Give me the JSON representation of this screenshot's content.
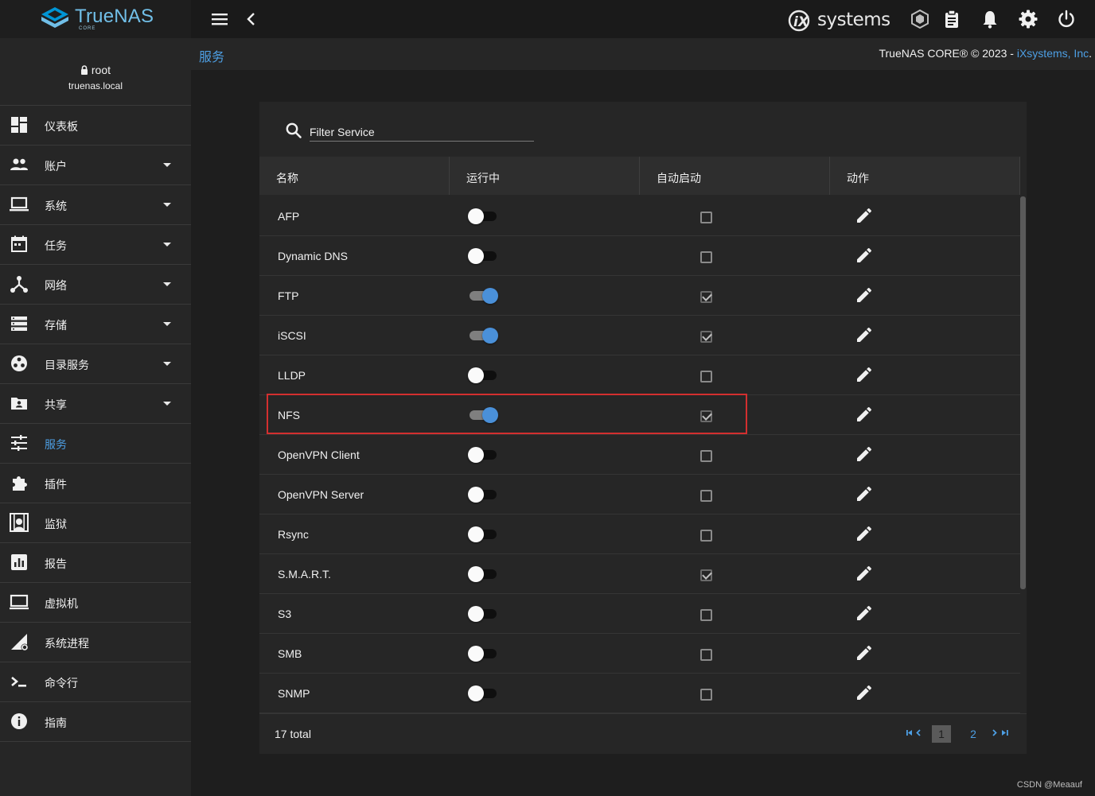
{
  "brand": {
    "name": "TrueNAS",
    "edition": "CORE"
  },
  "vendor": {
    "logo_mark": "iX",
    "logo_text": "systems"
  },
  "breadcrumb": "服务",
  "copyright": {
    "text": "TrueNAS CORE® © 2023 - ",
    "link": "iXsystems, Inc",
    "suffix": "."
  },
  "user": {
    "name": "root",
    "host": "truenas.local"
  },
  "nav": [
    {
      "label": "仪表板",
      "icon": "dashboard-icon",
      "caret": false,
      "active": false
    },
    {
      "label": "账户",
      "icon": "people-icon",
      "caret": true,
      "active": false
    },
    {
      "label": "系统",
      "icon": "laptop-icon",
      "caret": true,
      "active": false
    },
    {
      "label": "任务",
      "icon": "calendar-icon",
      "caret": true,
      "active": false
    },
    {
      "label": "网络",
      "icon": "network-icon",
      "caret": true,
      "active": false
    },
    {
      "label": "存储",
      "icon": "storage-icon",
      "caret": true,
      "active": false
    },
    {
      "label": "目录服务",
      "icon": "directory-icon",
      "caret": true,
      "active": false
    },
    {
      "label": "共享",
      "icon": "share-folder-icon",
      "caret": true,
      "active": false
    },
    {
      "label": "服务",
      "icon": "tune-icon",
      "caret": false,
      "active": true
    },
    {
      "label": "插件",
      "icon": "puzzle-icon",
      "caret": false,
      "active": false
    },
    {
      "label": "监狱",
      "icon": "jail-icon",
      "caret": false,
      "active": false
    },
    {
      "label": "报告",
      "icon": "chart-icon",
      "caret": false,
      "active": false
    },
    {
      "label": "虚拟机",
      "icon": "computer-icon",
      "caret": false,
      "active": false
    },
    {
      "label": "系统进程",
      "icon": "processes-icon",
      "caret": false,
      "active": false
    },
    {
      "label": "命令行",
      "icon": "terminal-icon",
      "caret": false,
      "active": false
    },
    {
      "label": "指南",
      "icon": "info-icon",
      "caret": false,
      "active": false
    }
  ],
  "filter": {
    "placeholder": "Filter Service"
  },
  "table": {
    "columns": [
      "名称",
      "运行中",
      "自动启动",
      "动作"
    ],
    "rows": [
      {
        "name": "AFP",
        "running": false,
        "autostart": false
      },
      {
        "name": "Dynamic DNS",
        "running": false,
        "autostart": false
      },
      {
        "name": "FTP",
        "running": true,
        "autostart": true
      },
      {
        "name": "iSCSI",
        "running": true,
        "autostart": true
      },
      {
        "name": "LLDP",
        "running": false,
        "autostart": false
      },
      {
        "name": "NFS",
        "running": true,
        "autostart": true
      },
      {
        "name": "OpenVPN Client",
        "running": false,
        "autostart": false
      },
      {
        "name": "OpenVPN Server",
        "running": false,
        "autostart": false
      },
      {
        "name": "Rsync",
        "running": false,
        "autostart": false
      },
      {
        "name": "S.M.A.R.T.",
        "running": false,
        "autostart": true
      },
      {
        "name": "S3",
        "running": false,
        "autostart": false
      },
      {
        "name": "SMB",
        "running": false,
        "autostart": false
      },
      {
        "name": "SNMP",
        "running": false,
        "autostart": false
      }
    ]
  },
  "footer": {
    "total": "17 total",
    "pages": [
      "1",
      "2"
    ],
    "current_page": "1"
  },
  "watermark": "CSDN @Meaauf",
  "colors": {
    "accent": "#4d9fe4",
    "toggle_on": "#4a90d9",
    "highlight": "#d32f2f"
  }
}
